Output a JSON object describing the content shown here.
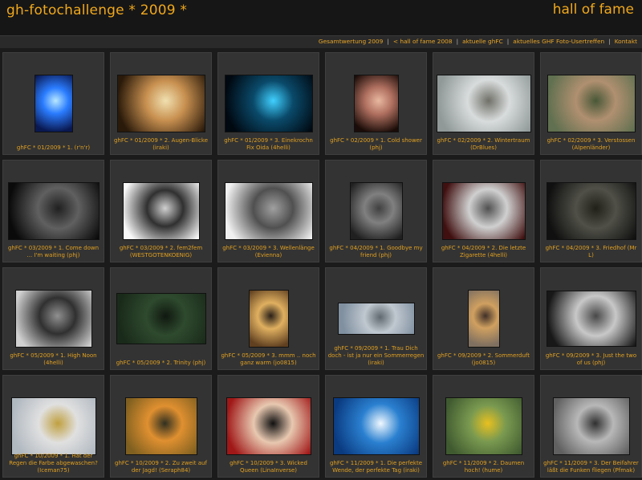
{
  "header": {
    "site_title": "gh-fotochallenge * 2009 *",
    "page_title": "hall of fame"
  },
  "nav": {
    "items": [
      "Gesamtwertung 2009",
      "< hall of fame 2008",
      "aktuelle ghFC",
      "aktuelles GHF Foto-Usertreffen",
      "Kontakt"
    ]
  },
  "photos": [
    {
      "caption": "ghFC * 01/2009 * 1. (r'n'r)",
      "colors": [
        "#0a1850",
        "#2a7cff",
        "#b8e8ff"
      ]
    },
    {
      "caption": "ghFC * 01/2009 * 2. Augen-Blicke (iraki)",
      "colors": [
        "#2a1a0a",
        "#c89050",
        "#f0e0b0"
      ]
    },
    {
      "caption": "ghFC * 01/2009 * 3. Einekrochn Fix Oida (4helli)",
      "colors": [
        "#000810",
        "#0a4a6a",
        "#40d0ff"
      ]
    },
    {
      "caption": "ghFC * 02/2009 * 1. Cold shower (phj)",
      "colors": [
        "#1a0c08",
        "#b07060",
        "#e8b8a0"
      ]
    },
    {
      "caption": "ghFC * 02/2009 * 2. Wintertraum (DrBlues)",
      "colors": [
        "#909898",
        "#d8dcdc",
        "#707068"
      ]
    },
    {
      "caption": "ghFC * 02/2009 * 3. Verstossen (Alpenländer)",
      "colors": [
        "#607050",
        "#b09070",
        "#485838"
      ]
    },
    {
      "caption": "ghFC * 03/2009 * 1. Come down ... I'm waiting (phj)",
      "colors": [
        "#0a0a0a",
        "#606060",
        "#202020"
      ]
    },
    {
      "caption": "ghFC * 03/2009 * 2. fem2fem (WESTGOTENKOENIG)",
      "colors": [
        "#f8f8f8",
        "#303030",
        "#d0d0d0"
      ]
    },
    {
      "caption": "ghFC * 03/2009 * 3. Wellenlänge (Evienna)",
      "colors": [
        "#f0f0f0",
        "#505050",
        "#a0a0a0"
      ]
    },
    {
      "caption": "ghFC * 04/2009 * 1. Goodbye my friend (phj)",
      "colors": [
        "#202020",
        "#808080",
        "#404040"
      ]
    },
    {
      "caption": "ghFC * 04/2009 * 2. Die letzte Zigarette (4helli)",
      "colors": [
        "#401010",
        "#d0d0d0",
        "#505050"
      ]
    },
    {
      "caption": "ghFC * 04/2009 * 3. Friedhof (Mr L)",
      "colors": [
        "#101010",
        "#505048",
        "#202018"
      ]
    },
    {
      "caption": "ghFC * 05/2009 * 1. High Noon (4helli)",
      "colors": [
        "#d0d0d0",
        "#303030",
        "#909090"
      ]
    },
    {
      "caption": "ghFC * 05/2009 * 2. Trinity (phj)",
      "colors": [
        "#1a2a1a",
        "#2e4a2e",
        "#101810"
      ]
    },
    {
      "caption": "ghFC * 05/2009 * 3. mmm .. noch ganz warm (jo0815)",
      "colors": [
        "#604020",
        "#e0b060",
        "#2a2018"
      ]
    },
    {
      "caption": "ghFC * 09/2009 * 1. Trau Dich doch - ist ja nur ein Sommerregen (iraki)",
      "colors": [
        "#8090a0",
        "#c0c8d0",
        "#606870"
      ]
    },
    {
      "caption": "ghFC * 09/2009 * 2. Sommerduft (jo0815)",
      "colors": [
        "#807060",
        "#d0a060",
        "#403028"
      ]
    },
    {
      "caption": "ghFC * 09/2009 * 3. Just the two of us (phj)",
      "colors": [
        "#181818",
        "#c8c8c8",
        "#484848"
      ]
    },
    {
      "caption": "ghFC * 10/2009 * 1. Hat der Regen die Farbe abgewaschen? (Iceman75)",
      "colors": [
        "#b0b8c0",
        "#e0e0e0",
        "#c0a040"
      ]
    },
    {
      "caption": "ghFC * 10/2009 * 2. Zu zweit auf der Jagd! (Seraph84)",
      "colors": [
        "#806020",
        "#e09030",
        "#303020"
      ]
    },
    {
      "caption": "ghFC * 10/2009 * 3. Wicked Queen (LinaInverse)",
      "colors": [
        "#a01818",
        "#e8c8b0",
        "#101010"
      ]
    },
    {
      "caption": "ghFC * 11/2009 * 1. Die perfekte Wende, der perfekte Tag (iraki)",
      "colors": [
        "#0a3a80",
        "#2a80d0",
        "#f0f8ff"
      ]
    },
    {
      "caption": "ghFC * 11/2009 * 2. Daumen hoch! (hume)",
      "colors": [
        "#405a30",
        "#7a9a50",
        "#e8c020"
      ]
    },
    {
      "caption": "ghFC * 11/2009 * 3. Der Beifahrer läßt die Funken fliegen (Pfmak)",
      "colors": [
        "#606060",
        "#b8b8b8",
        "#303030"
      ]
    }
  ]
}
